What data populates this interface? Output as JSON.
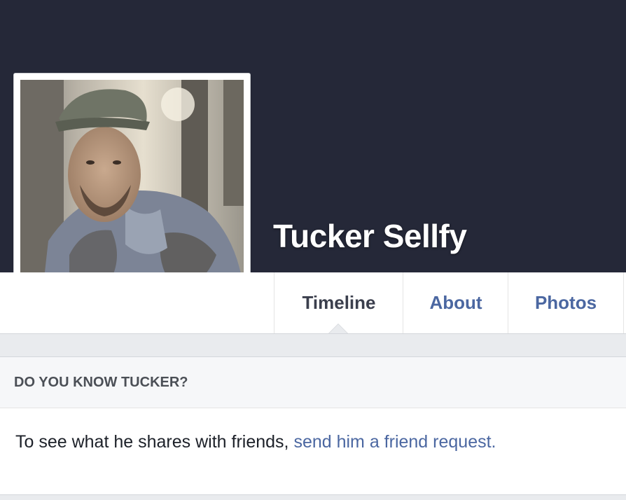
{
  "profile": {
    "name": "Tucker Sellfy",
    "photo_icon": "profile-photo"
  },
  "tabs": [
    {
      "label": "Timeline",
      "active": true
    },
    {
      "label": "About",
      "active": false
    },
    {
      "label": "Photos",
      "active": false
    }
  ],
  "know_card": {
    "heading": "DO YOU KNOW TUCKER?",
    "body_text": "To see what he shares with friends,",
    "link_text": "send him a friend request."
  },
  "colors": {
    "cover": "#252838",
    "link": "#4b67a1",
    "active_tab": "#3b3f4d"
  }
}
